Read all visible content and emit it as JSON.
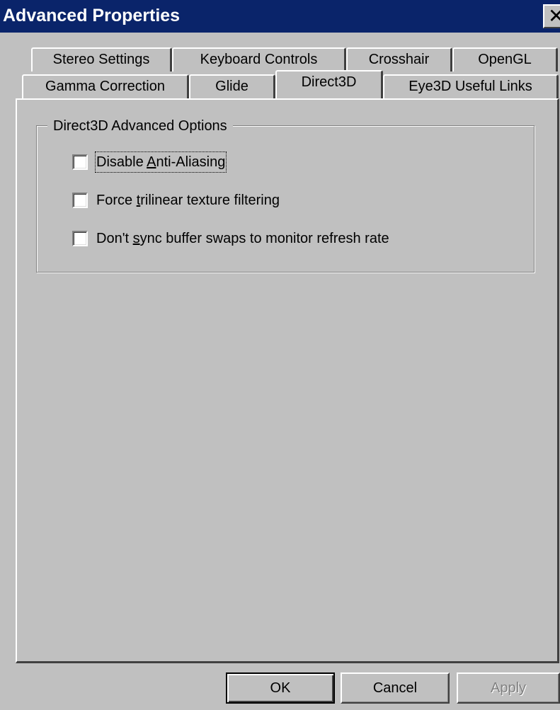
{
  "window": {
    "title": "Advanced Properties",
    "close_glyph": "✕"
  },
  "tabs_row1": [
    {
      "label": "Stereo Settings"
    },
    {
      "label": "Keyboard Controls"
    },
    {
      "label": "Crosshair"
    },
    {
      "label": "OpenGL"
    }
  ],
  "tabs_row2": [
    {
      "label": "Gamma Correction"
    },
    {
      "label": "Glide"
    },
    {
      "label": "Direct3D",
      "selected": true
    },
    {
      "label": "Eye3D Useful Links"
    }
  ],
  "group": {
    "title": "Direct3D Advanced Options"
  },
  "options": [
    {
      "label_before": "",
      "mnemonic": "",
      "label_after": "Disable ",
      "mnemonic2": "A",
      "label_tail": "nti-Aliasing",
      "checked": false,
      "focused": true
    },
    {
      "label_before": "Force ",
      "mnemonic": "t",
      "label_after": "rilinear texture filtering",
      "checked": false
    },
    {
      "label_before": "Don't ",
      "mnemonic": "s",
      "label_after": "ync buffer swaps to monitor refresh rate",
      "checked": false
    }
  ],
  "buttons": {
    "ok": "OK",
    "cancel": "Cancel",
    "apply": "Apply"
  },
  "colors": {
    "titlebar": "#0a246a",
    "face": "#c0c0c0"
  }
}
